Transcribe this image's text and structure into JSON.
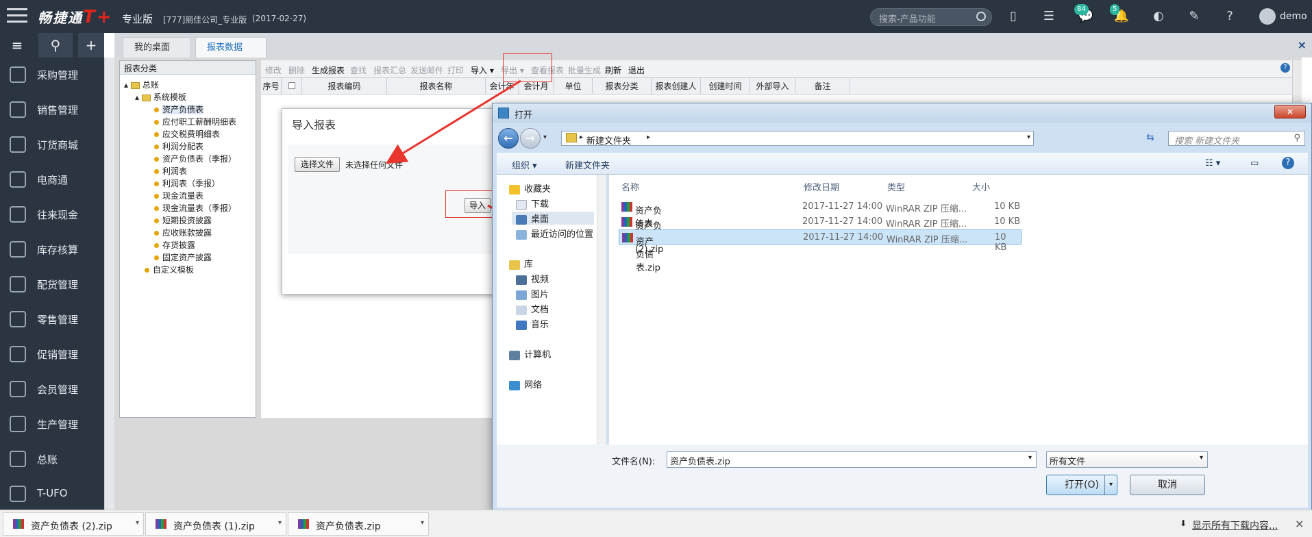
{
  "topbar": {
    "logo": "畅捷通",
    "logo_mark": "T+",
    "edition": "专业版",
    "company": "[777]丽佳公司_专业版",
    "date": "(2017-02-27)",
    "search_placeholder": "搜索-产品功能",
    "msg_badge": "84",
    "notice_badge": "5",
    "user": "demo"
  },
  "leftnav": {
    "items": [
      "采购管理",
      "销售管理",
      "订货商城",
      "电商通",
      "往来现金",
      "库存核算",
      "配货管理",
      "零售管理",
      "促销管理",
      "会员管理",
      "生产管理",
      "总账",
      "T-UFO"
    ]
  },
  "tabs": [
    {
      "label": "我的桌面"
    },
    {
      "label": "报表数据",
      "close": "×"
    }
  ],
  "category_panel": {
    "header": "报表分类",
    "root": "总账",
    "group": "系统模板",
    "items": [
      "资产负债表",
      "应付职工薪酬明细表",
      "应交税费明细表",
      "利润分配表",
      "资产负债表（季报）",
      "利润表",
      "利润表（季报）",
      "现金流量表",
      "现金流量表（季报）",
      "短期投资披露",
      "应收账款披露",
      "存货披露",
      "固定资产披露"
    ],
    "custom": "自定义模板"
  },
  "toolbar": [
    "修改",
    "删除",
    "生成报表",
    "查找",
    "报表汇总",
    "发送邮件",
    "打印",
    "导入",
    "导出",
    "查看报表",
    "批量生成",
    "刷新",
    "退出"
  ],
  "grid_headers": [
    "序号",
    "",
    "报表编码",
    "报表名称",
    "会计年",
    "会计月",
    "单位",
    "报表分类",
    "报表创建人",
    "创建时间",
    "外部导入",
    "备注"
  ],
  "import_dialog": {
    "title": "导入报表",
    "choose": "选择文件",
    "no_file": "未选择任何文件",
    "import_btn": "导入"
  },
  "open_dialog": {
    "title": "打开",
    "path": "新建文件夹",
    "search_placeholder": "搜索 新建文件夹",
    "organize": "组织",
    "new_folder": "新建文件夹",
    "nav": {
      "favorites": "收藏夹",
      "downloads": "下载",
      "desktop": "桌面",
      "recent": "最近访问的位置",
      "libraries": "库",
      "videos": "视频",
      "pictures": "图片",
      "docs": "文档",
      "music": "音乐",
      "computer": "计算机",
      "network": "网络"
    },
    "columns": [
      "名称",
      "修改日期",
      "类型",
      "大小"
    ],
    "files": [
      {
        "name": "资产负债表 (1).zip",
        "date": "2017-11-27 14:00",
        "type": "WinRAR ZIP 压缩...",
        "size": "10 KB"
      },
      {
        "name": "资产负债表 (2).zip",
        "date": "2017-11-27 14:00",
        "type": "WinRAR ZIP 压缩...",
        "size": "10 KB"
      },
      {
        "name": "资产负债表.zip",
        "date": "2017-11-27 14:00",
        "type": "WinRAR ZIP 压缩...",
        "size": "10 KB"
      }
    ],
    "filename_label": "文件名(N):",
    "filename_value": "资产负债表.zip",
    "filetype": "所有文件",
    "open_btn": "打开(O)",
    "cancel_btn": "取消"
  },
  "taskbar": {
    "downloads": [
      "资产负债表 (2).zip",
      "资产负债表 (1).zip",
      "资产负债表.zip"
    ],
    "show_all": "显示所有下载内容...",
    "close": "×"
  },
  "colors": {
    "accent_red": "#e8352e",
    "nav_bg": "#2b3542",
    "link_blue": "#1f6fb8"
  }
}
